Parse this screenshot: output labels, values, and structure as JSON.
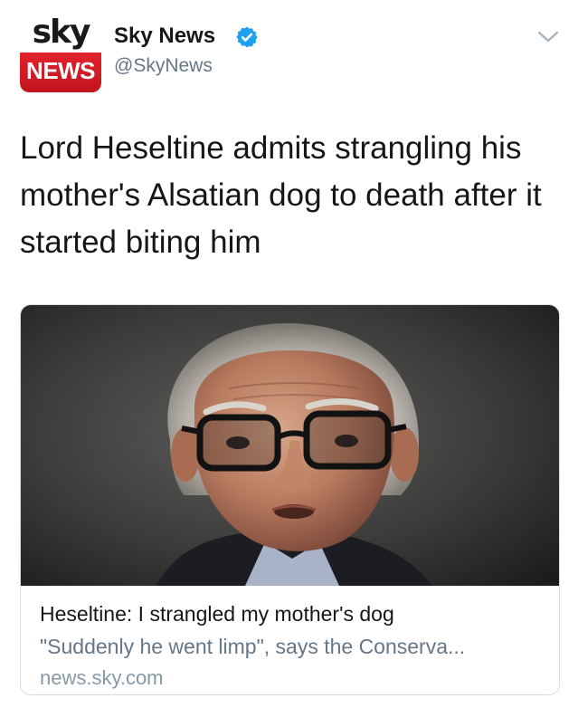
{
  "tweet": {
    "author": {
      "avatar_logo_top": "sky",
      "avatar_logo_bottom": "NEWS",
      "name": "Sky News",
      "handle": "@SkyNews",
      "verified_icon": "verified-badge-icon",
      "menu_icon": "chevron-down-icon"
    },
    "text": "Lord Heseltine admits strangling his mother's Alsatian dog to death after it started biting him",
    "card": {
      "image_alt": "Portrait photo of an older man with grey hair and dark-rimmed glasses",
      "title": "Heseltine: I strangled my mother's dog",
      "description": "\"Suddenly he went limp\", says the Conserva...",
      "domain": "news.sky.com"
    }
  },
  "colors": {
    "text_primary": "#14171a",
    "text_secondary": "#657786",
    "verified_blue": "#1da1f2",
    "card_border": "#d6dde3",
    "brand_red": "#d11c26"
  }
}
